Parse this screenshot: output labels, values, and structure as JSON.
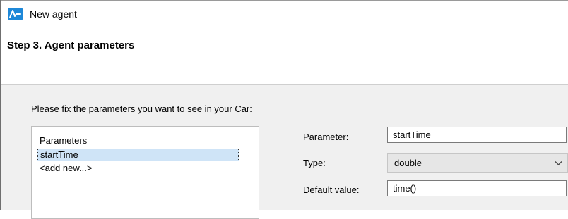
{
  "window": {
    "title": "New agent",
    "app_icon": "anylogic-logo-icon"
  },
  "wizard": {
    "step_title": "Step 3. Agent parameters",
    "instruction": "Please fix the parameters you want to see in your Car:"
  },
  "parameters_list": {
    "header": "Parameters",
    "items": [
      "startTime",
      "<add new...>"
    ],
    "selected_index": 0
  },
  "form": {
    "parameter_label": "Parameter:",
    "parameter_value": "startTime",
    "type_label": "Type:",
    "type_value": "double",
    "default_value_label": "Default value:",
    "default_value_value": "time()"
  },
  "colors": {
    "accent_blue": "#1e88d8",
    "selection": "#cfe4f7",
    "content_background": "#f0f0f0",
    "select_background": "#e6e6e6"
  }
}
